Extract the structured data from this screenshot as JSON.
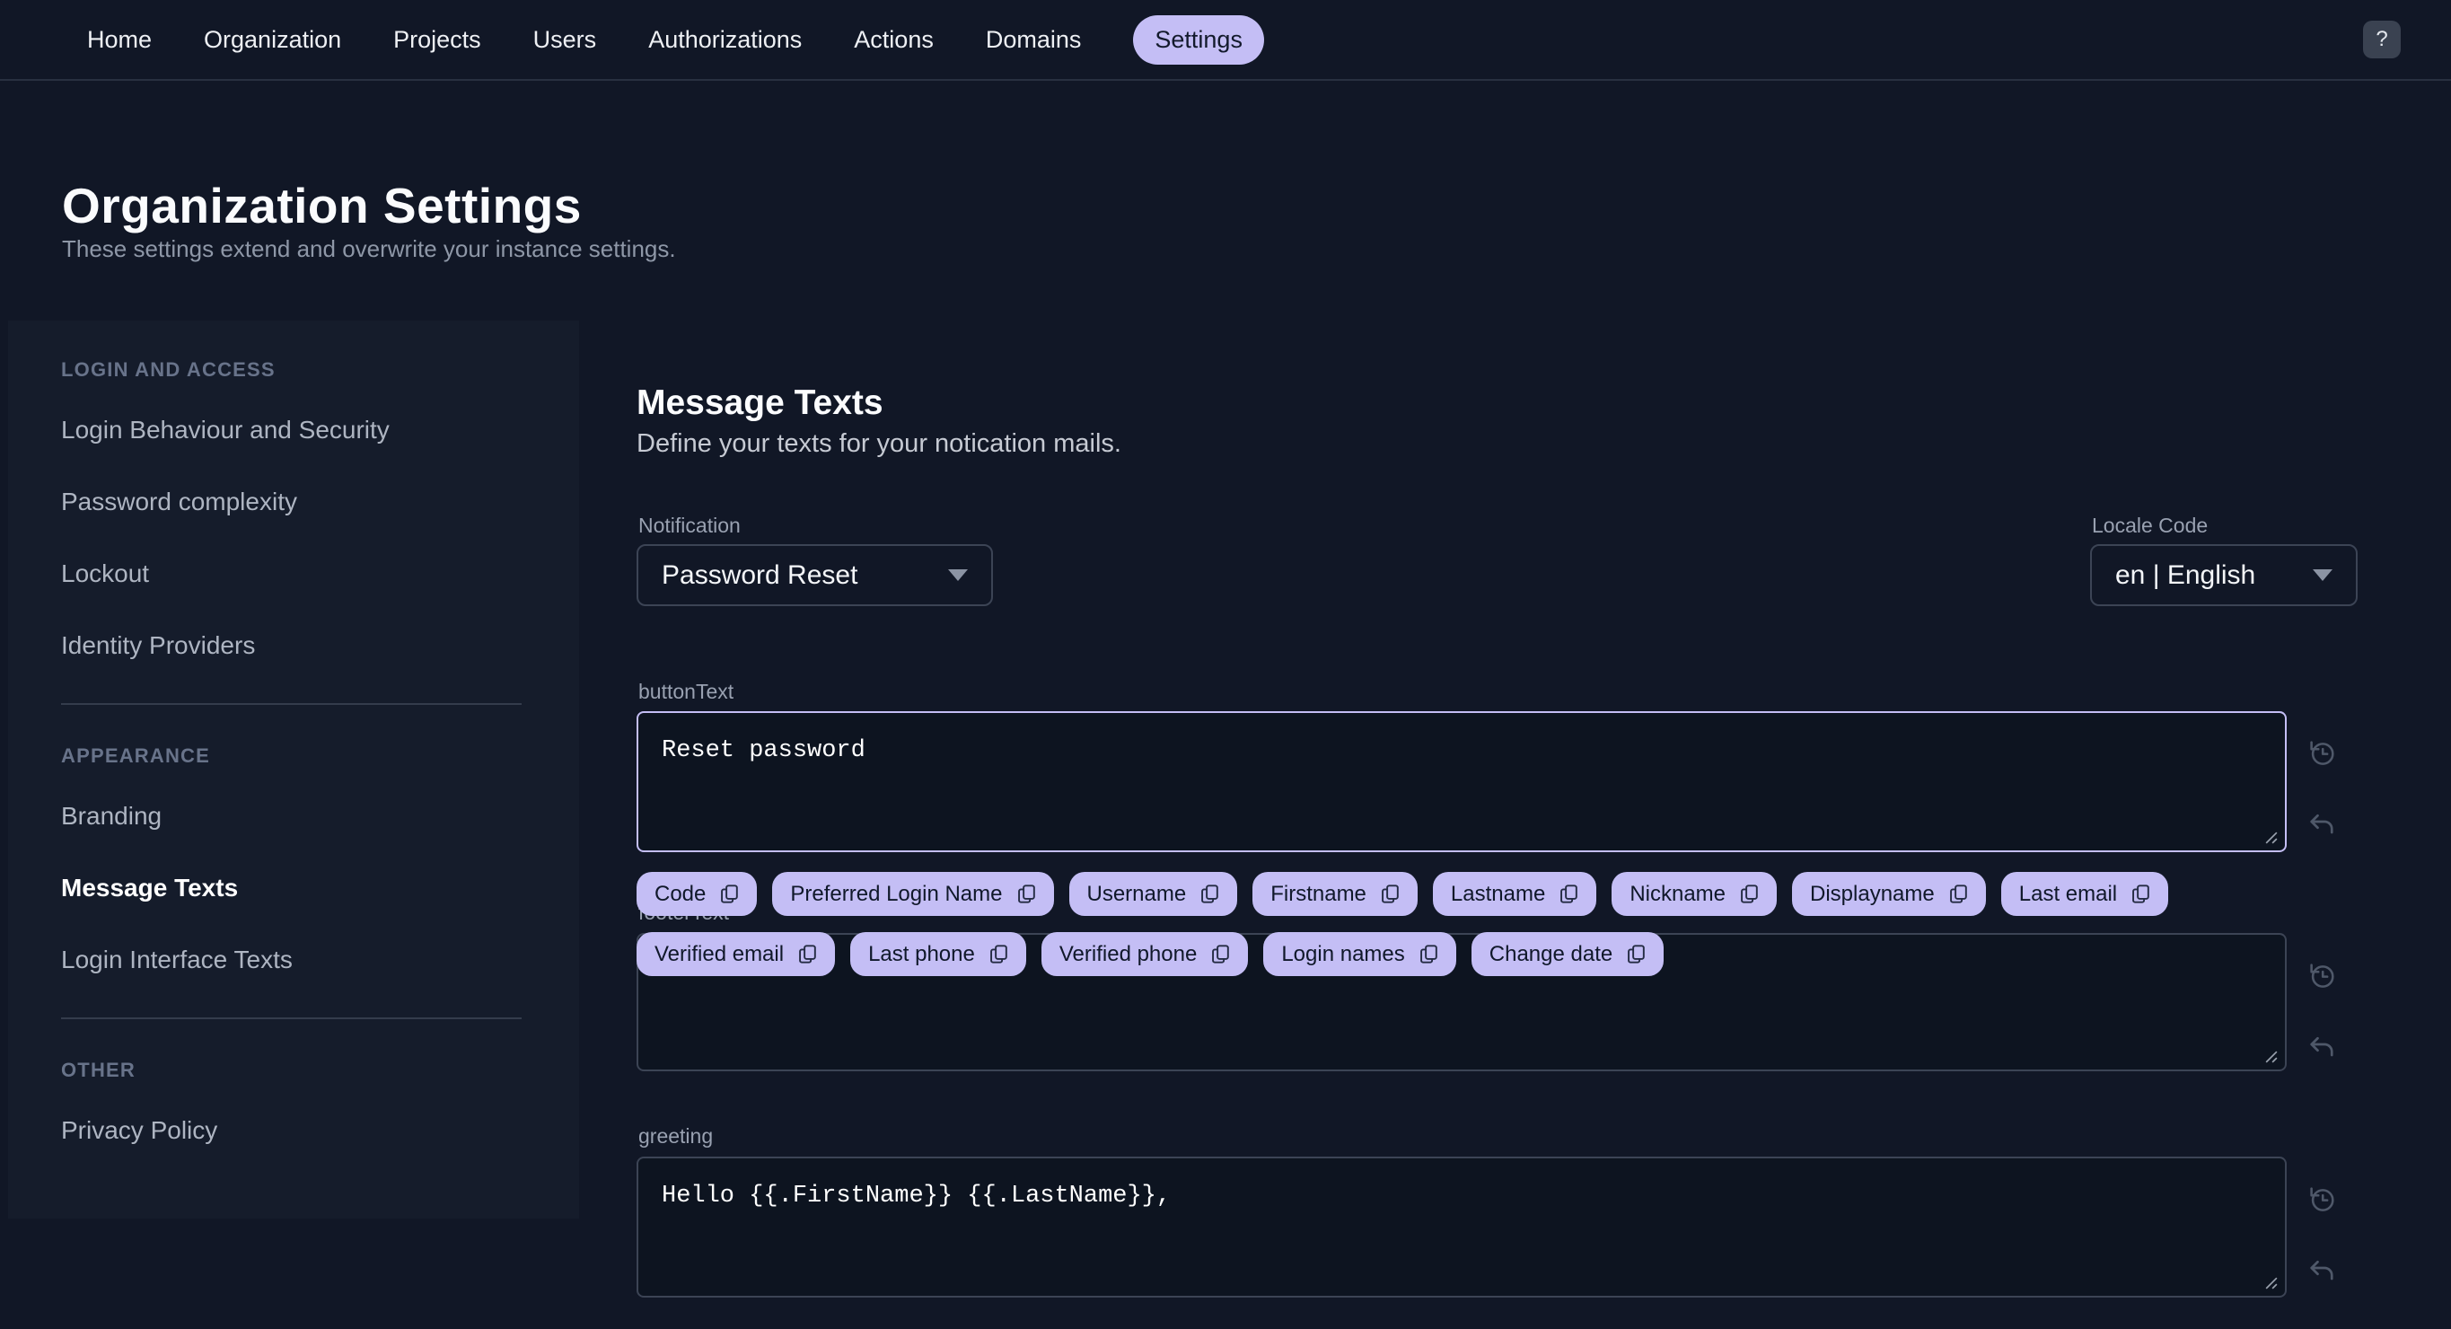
{
  "colors": {
    "accent": "#c4bef5",
    "accent-text": "#131a2c",
    "page-bg": "#111726",
    "sidebar-bg": "#151c2b",
    "field-bg": "#0d1420",
    "border-muted": "#3c4455"
  },
  "nav": {
    "items": [
      "Home",
      "Organization",
      "Projects",
      "Users",
      "Authorizations",
      "Actions",
      "Domains",
      "Settings"
    ],
    "active_item": "Settings",
    "help_button_label": "?"
  },
  "page_header": {
    "title": "Organization Settings",
    "subtitle": "These settings extend and overwrite your instance settings."
  },
  "sidebar": {
    "sections": [
      {
        "title": "LOGIN AND ACCESS",
        "items": [
          "Login Behaviour and Security",
          "Password complexity",
          "Lockout",
          "Identity Providers"
        ]
      },
      {
        "title": "APPEARANCE",
        "items": [
          "Branding",
          "Message Texts",
          "Login Interface Texts"
        ]
      },
      {
        "title": "OTHER",
        "items": [
          "Privacy Policy"
        ]
      }
    ],
    "active_item": "Message Texts"
  },
  "main": {
    "title": "Message Texts",
    "subtitle": "Define your texts for your notication mails.",
    "notification_select": {
      "label": "Notification",
      "value": "Password Reset"
    },
    "locale_select": {
      "label": "Locale Code",
      "value": "en | English"
    },
    "fields": {
      "button_text": {
        "label": "buttonText",
        "value": "Reset password"
      },
      "footer_text": {
        "label": "footerText",
        "value": ""
      },
      "greeting": {
        "label": "greeting",
        "value": "Hello {{.FirstName}} {{.LastName}},"
      }
    },
    "variable_chips": [
      "Code",
      "Preferred Login Name",
      "Username",
      "Firstname",
      "Lastname",
      "Nickname",
      "Displayname",
      "Last email",
      "Verified email",
      "Last phone",
      "Verified phone",
      "Login names",
      "Change date"
    ]
  }
}
